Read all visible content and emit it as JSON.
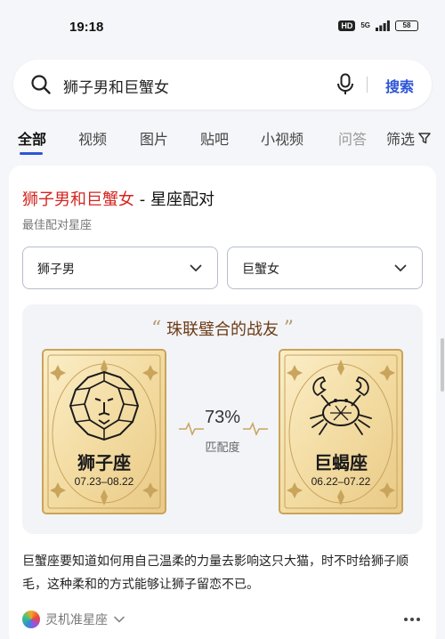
{
  "status_bar": {
    "time": "19:18",
    "hd": "HD",
    "network": "5G",
    "battery": "58"
  },
  "search": {
    "query": "狮子男和巨蟹女",
    "button_label": "搜索",
    "icons": [
      "search-icon",
      "mic-icon"
    ]
  },
  "tabs": {
    "items": [
      "全部",
      "视频",
      "图片",
      "贴吧",
      "小视频",
      "问答"
    ],
    "active": "全部",
    "filter_label": "筛选"
  },
  "result": {
    "title_highlight": "狮子男和巨蟹女",
    "title_rest": " - 星座配对",
    "subtitle": "最佳配对星座",
    "select_male": "狮子男",
    "select_female": "巨蟹女",
    "match_title": "珠联璧合的战友",
    "quote_open": "“",
    "quote_close": "”",
    "left_sign": {
      "name": "狮子座",
      "dates": "07.23–08.22",
      "icon": "lion-icon"
    },
    "right_sign": {
      "name": "巨蝎座",
      "dates": "06.22–07.22",
      "icon": "crab-icon"
    },
    "percent": "73%",
    "percent_label": "匹配度",
    "description": "巨蟹座要知道如何用自己温柔的力量去影响这只大猫，时不时给狮子顺毛，这种柔和的方式能够让狮子留恋不已。",
    "source": "灵机准星座"
  },
  "colors": {
    "accent": "#2e55d6",
    "highlight": "#d4241f",
    "gold": "#c9a45c"
  }
}
